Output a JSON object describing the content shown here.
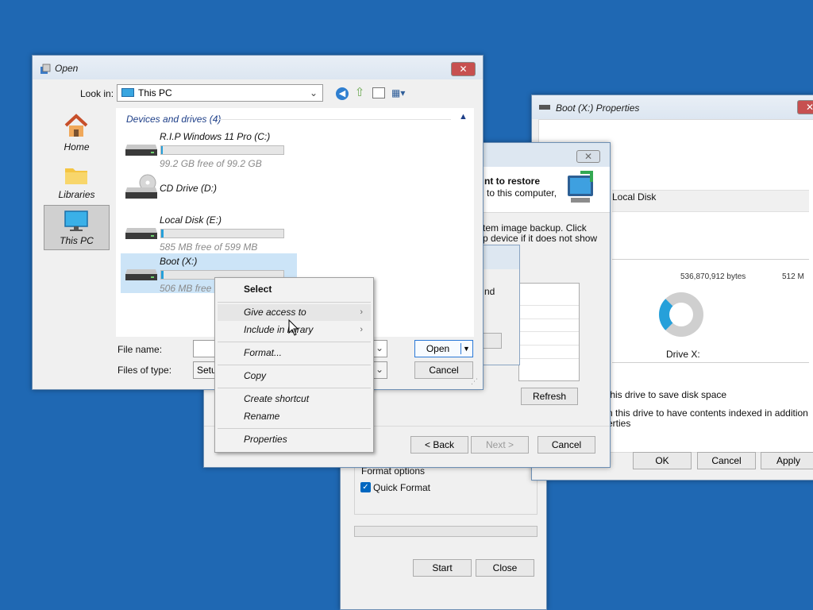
{
  "open_dialog": {
    "title": "Open",
    "look_in_label": "Look in:",
    "look_in_value": "This PC",
    "nav": [
      {
        "label": "Home"
      },
      {
        "label": "Libraries"
      },
      {
        "label": "This PC"
      }
    ],
    "group_header": "Devices and drives (4)",
    "drives": [
      {
        "name": "R.I.P Windows 11 Pro (C:)",
        "free": "99.2 GB free of 99.2 GB",
        "used_fraction": 0.0
      },
      {
        "name": "CD Drive (D:)",
        "free": ""
      },
      {
        "name": "Local Disk (E:)",
        "free": "585 MB free of 599 MB",
        "used_fraction": 0.02
      },
      {
        "name": "Boot (X:)",
        "free": "506 MB free",
        "used_fraction": 0.02
      }
    ],
    "file_name_label": "File name:",
    "file_name_value": "",
    "files_of_type_label": "Files of type:",
    "files_of_type_value": "Setup",
    "open_button": "Open",
    "cancel_button": "Cancel"
  },
  "context_menu": {
    "items": [
      {
        "label": "Select"
      },
      {
        "label": "Give access to",
        "arrow": "›"
      },
      {
        "label": "Include in library",
        "arrow": "›"
      },
      {
        "label": "Format..."
      },
      {
        "label": "Copy"
      },
      {
        "label": "Create shortcut"
      },
      {
        "label": "Rename"
      },
      {
        "label": "Properties"
      }
    ]
  },
  "restore_wizard": {
    "heading_partial": "nt to restore",
    "subtext_partial": "to this computer,",
    "text_line1": "tem image backup. Click",
    "text_line2": "p device if it does not show",
    "inner_text": "nd",
    "refresh_button": "Refresh",
    "back_button": "< Back",
    "next_button": "Next >",
    "cancel_button": "Cancel"
  },
  "format_dialog": {
    "format_options_label": "Format options",
    "quick_format_label": "Quick Format",
    "quick_format_checked": true,
    "start_button": "Start",
    "close_button": "Close"
  },
  "properties_dialog": {
    "title": "Boot (X:) Properties",
    "type_value": "Local Disk",
    "partial_numbers": "536,870,912 bytes",
    "partial_numbers_right": "512 M",
    "drive_label": "Drive X:",
    "compress_text": "this drive to save disk space",
    "index_text_line1": "n this drive to have contents indexed in addition",
    "index_text_line2": "erties",
    "ok_button": "OK",
    "cancel_button": "Cancel",
    "apply_button": "Apply"
  },
  "colors": {
    "desktop": "#1f68b3",
    "selection": "#cce4f7",
    "accent": "#26a0da"
  }
}
